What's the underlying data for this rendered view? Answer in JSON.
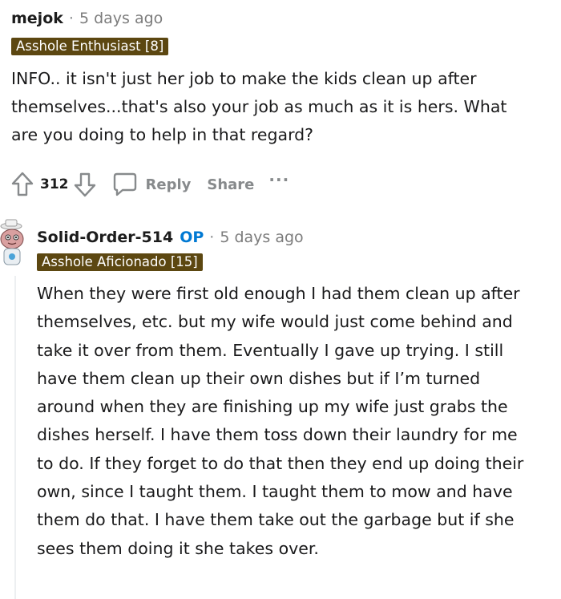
{
  "comments": [
    {
      "author": "mejok",
      "separator": "·",
      "time": "5 days ago",
      "flair": "Asshole Enthusiast [8]",
      "body": "INFO.. it isn't just her job to make the kids clean up after themselves...that's also your job as much as it is hers. What are you doing to help in that regard?",
      "score": "312",
      "actions": {
        "reply": "Reply",
        "share": "Share",
        "more": "···"
      }
    },
    {
      "author": "Solid-Order-514",
      "op_badge": "OP",
      "separator": "·",
      "time": "5 days ago",
      "flair": "Asshole Aficionado [15]",
      "body": "When they were first old enough I had them clean up after themselves, etc. but my wife would just come behind and take it over from them. Eventually I gave up trying. I still have them clean up their own dishes but if I’m turned around when they are finishing up my wife just grabs the dishes herself. I have them toss down their laundry for me to do. If they forget to do that then they end up doing their own, since I taught them. I taught them to mow and have them do that. I have them take out the garbage but if she sees them doing it she takes over."
    }
  ],
  "icons": {
    "upvote": "upvote-arrow-icon",
    "downvote": "downvote-arrow-icon",
    "reply": "speech-bubble-icon",
    "avatar": "snoo-avatar-icon"
  },
  "colors": {
    "flair_bg": "#5c4711",
    "op_blue": "#0079d3",
    "meta_gray": "#7c7c7c"
  }
}
